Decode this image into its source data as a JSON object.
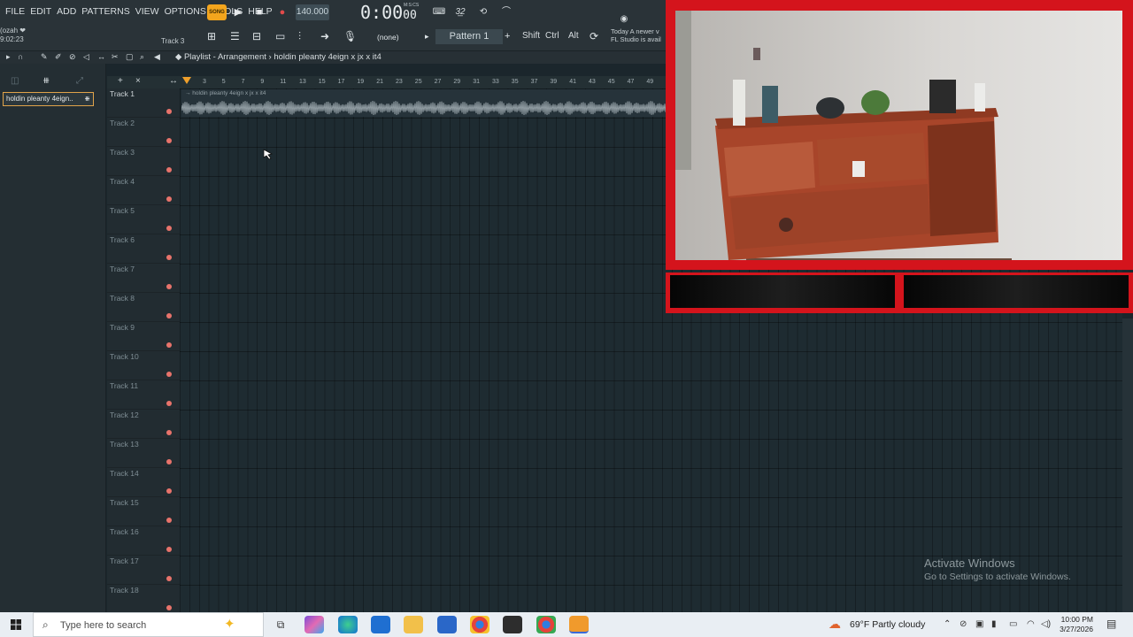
{
  "menu": [
    "FILE",
    "EDIT",
    "ADD",
    "PATTERNS",
    "VIEW",
    "OPTIONS",
    "TOOLS",
    "HELP"
  ],
  "transport": {
    "song_label": "SONG",
    "tempo": "140.000",
    "time": "0:00",
    "time_cs": "00",
    "time_label": "M:S:CS"
  },
  "hint": {
    "line1": "(ozah ❤",
    "line2": "9:02:23",
    "track_hint": "Track 3"
  },
  "toolbar": {
    "pattern_select": "(none)",
    "pattern": "Pattern 1",
    "shift": "Shift",
    "ctrl": "Ctrl",
    "alt": "Alt"
  },
  "news": {
    "line1": "Today  A newer v",
    "line2": "FL Studio is avail"
  },
  "playlist": {
    "title": "Playlist - Arrangement",
    "separator": "›",
    "project": "holdin pleanty 4eign x jx x it4"
  },
  "left_panel": {
    "pattern_item": "holdin pleanty 4eign.."
  },
  "ruler_ticks": [
    "3",
    "5",
    "7",
    "9",
    "11",
    "13",
    "15",
    "17",
    "19",
    "21",
    "23",
    "25",
    "27",
    "29",
    "31",
    "33",
    "35",
    "37",
    "39",
    "41",
    "43",
    "45",
    "47",
    "49"
  ],
  "tracks": [
    "Track 1",
    "Track 2",
    "Track 3",
    "Track 4",
    "Track 5",
    "Track 6",
    "Track 7",
    "Track 8",
    "Track 9",
    "Track 10",
    "Track 11",
    "Track 12",
    "Track 13",
    "Track 14",
    "Track 15",
    "Track 16",
    "Track 17",
    "Track 18"
  ],
  "clip": {
    "name": "→ holdin pleanty 4eign x jx x it4"
  },
  "watermark": {
    "title": "Activate Windows",
    "subtitle": "Go to Settings to activate Windows."
  },
  "taskbar": {
    "search_placeholder": "Type here to search",
    "weather": "69°F  Partly cloudy",
    "time": "10:00 PM",
    "date": "3/27/2026"
  },
  "colors": {
    "accent": "#f0a02b",
    "overlay_red": "#d4141c",
    "track_dot": "#e8736b"
  }
}
